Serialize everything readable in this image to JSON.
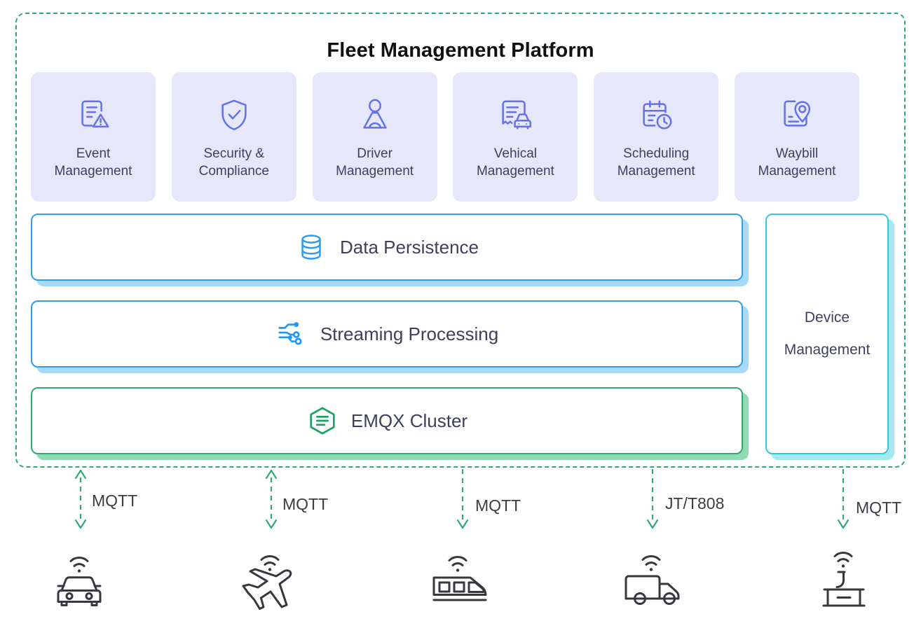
{
  "diagram": {
    "title": "Fleet Management Platform",
    "accent_colors": {
      "platform_border": "#2eaa6e",
      "card_bg": "#e6e7fb",
      "card_icon": "#6472e8",
      "bar_blue": "#2f9ceb",
      "bar_green": "#2eaa6e",
      "device_panel": "#31c8dd",
      "text": "#3e3f5e",
      "device_icon": "#37373d"
    }
  },
  "modules": [
    {
      "label": "Event\nManagement",
      "icon": "document-alert-icon"
    },
    {
      "label": "Security &\nCompliance",
      "icon": "shield-check-icon"
    },
    {
      "label": "Driver\nManagement",
      "icon": "person-icon"
    },
    {
      "label": "Vehical\nManagement",
      "icon": "document-car-icon"
    },
    {
      "label": "Scheduling\nManagement",
      "icon": "calendar-clock-icon"
    },
    {
      "label": "Waybill\nManagement",
      "icon": "document-location-icon"
    }
  ],
  "layers": [
    {
      "label": "Data Persistence",
      "icon": "database-icon",
      "color": "#2f9ceb"
    },
    {
      "label": "Streaming Processing",
      "icon": "streaming-nodes-icon",
      "color": "#2f9ceb"
    },
    {
      "label": "EMQX Cluster",
      "icon": "emqx-hexagon-icon",
      "color": "#2eaa6e"
    }
  ],
  "device_management": {
    "label": "Device\nManagement"
  },
  "connections": [
    {
      "protocol": "MQTT",
      "direction": "bidirectional",
      "device": "car-icon"
    },
    {
      "protocol": "MQTT",
      "direction": "bidirectional",
      "device": "airplane-icon"
    },
    {
      "protocol": "MQTT",
      "direction": "down",
      "device": "train-icon"
    },
    {
      "protocol": "JT/T808",
      "direction": "down",
      "device": "truck-icon"
    },
    {
      "protocol": "MQTT",
      "direction": "down",
      "device": "crane-container-icon"
    }
  ]
}
